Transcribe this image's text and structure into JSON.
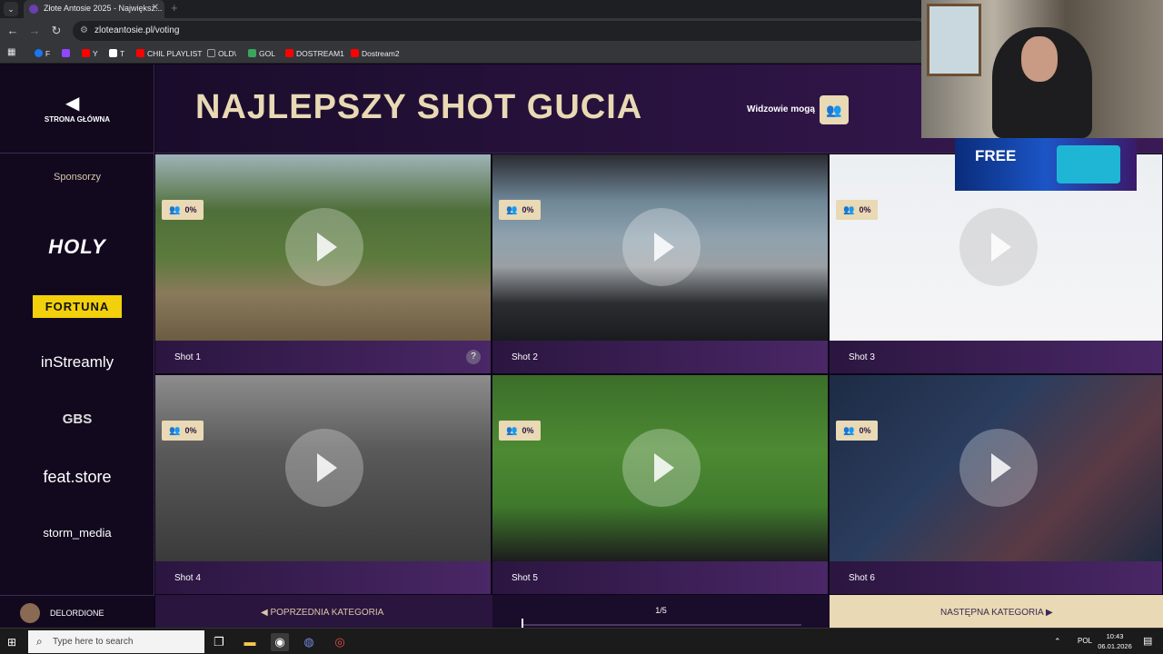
{
  "browser": {
    "tab_title": "Złote Antosie 2025 - Największ...",
    "tab_close": "✕",
    "tab_menu": "⌄",
    "new_tab": "+",
    "url": "zloteantosie.pl/voting",
    "bookmarks": [
      {
        "label": "F",
        "color": "#1877f2"
      },
      {
        "label": "",
        "color": "#9146ff"
      },
      {
        "label": "Y",
        "color": "#ff0000"
      },
      {
        "label": "T",
        "color": "#ffffff"
      },
      {
        "label": "CHIL PLAYLIST",
        "color": "#ff0000"
      },
      {
        "label": "OLD\\",
        "color": "#9aa0a6"
      },
      {
        "label": "GOL",
        "color": "#3aa55d"
      },
      {
        "label": "DOSTREAM1",
        "color": "#ff0000"
      },
      {
        "label": "Dostream2",
        "color": "#ff0000"
      }
    ]
  },
  "sidebar": {
    "home_label": "STRONA GŁÓWNA",
    "sponsors_title": "Sponsorzy",
    "sponsors": [
      "HOLY",
      "FORTUNA",
      "inStreamly",
      "GBS",
      "feat.store",
      "storm_media"
    ]
  },
  "header": {
    "title": "NAJLEPSZY SHOT GUCIA",
    "viewers_label": "Widzowie mogą"
  },
  "shots": [
    {
      "label": "Shot 1",
      "percent": "0%",
      "help": "?"
    },
    {
      "label": "Shot 2",
      "percent": "0%"
    },
    {
      "label": "Shot 3",
      "percent": "0%"
    },
    {
      "label": "Shot 4",
      "percent": "0%"
    },
    {
      "label": "Shot 5",
      "percent": "0%"
    },
    {
      "label": "Shot 6",
      "percent": "0%"
    }
  ],
  "footer": {
    "user_name": "DELORDIONE",
    "prev_label": "POPRZEDNIA KATEGORIA",
    "pagination": "1/5",
    "next_label": "NASTĘPNA KATEGORIA"
  },
  "overlay": {
    "free_text": "FREE"
  },
  "taskbar": {
    "search_placeholder": "Type here to search",
    "language": "POL",
    "time": "10:43",
    "date": "06.01.2026"
  }
}
